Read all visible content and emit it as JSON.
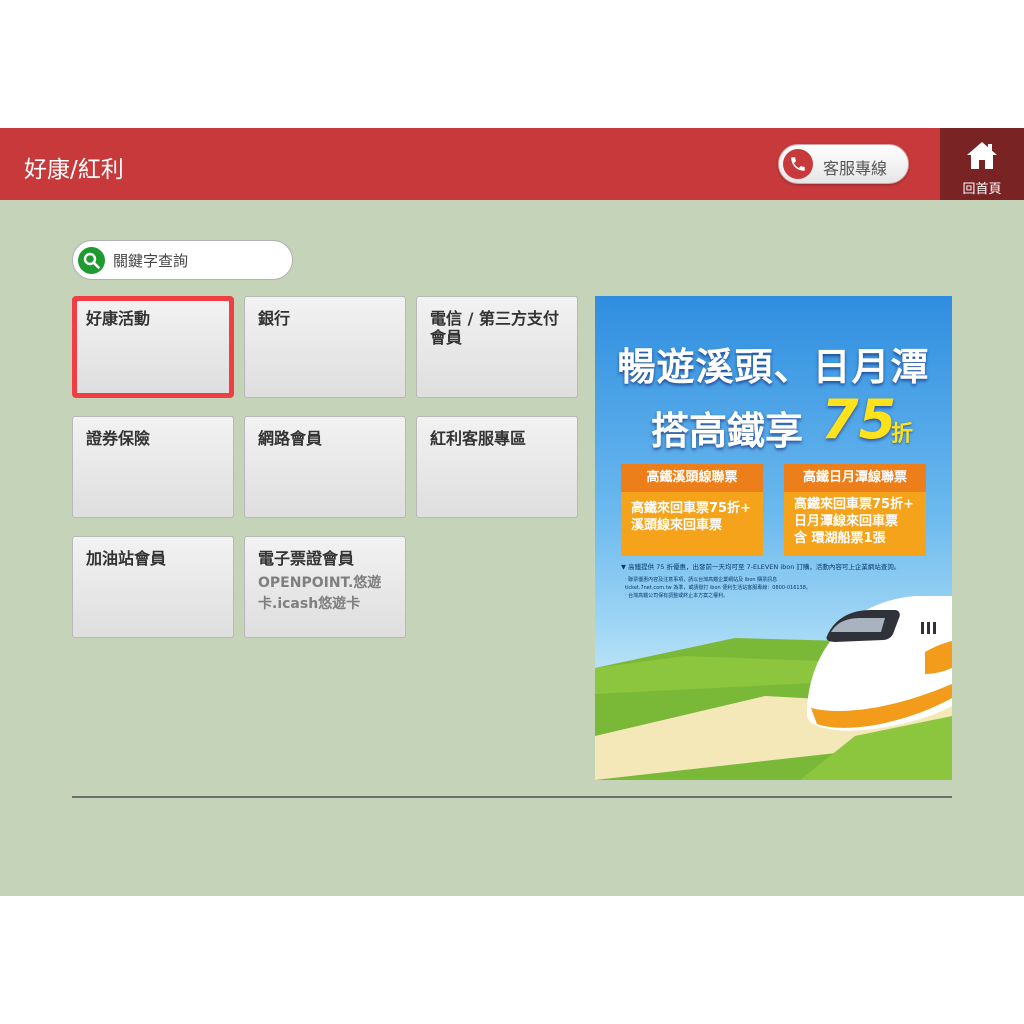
{
  "header": {
    "title": "好康/紅利",
    "customer_service_label": "客服專線",
    "home_label": "回首頁"
  },
  "search": {
    "placeholder": "關鍵字查詢"
  },
  "tiles": [
    {
      "label": "好康活動",
      "sub": "",
      "selected": true
    },
    {
      "label": "銀行",
      "sub": ""
    },
    {
      "label": "電信 / 第三方支付會員",
      "sub": ""
    },
    {
      "label": "證券保險",
      "sub": ""
    },
    {
      "label": "網路會員",
      "sub": ""
    },
    {
      "label": "紅利客服專區",
      "sub": ""
    },
    {
      "label": "加油站會員",
      "sub": ""
    },
    {
      "label": "電子票證會員",
      "sub": "OPENPOINT.悠遊卡.icash悠遊卡"
    }
  ],
  "ad": {
    "headline_1": "暢遊溪頭、日月潭",
    "headline_2": "搭高鐵享",
    "discount_number": "75",
    "discount_unit": "折",
    "box_left": {
      "head": "高鐵溪頭線聯票",
      "line1": "高鐵來回車票75折+",
      "line2": "溪頭線來回車票"
    },
    "box_right": {
      "head": "高鐵日月潭線聯票",
      "line1": "高鐵來回車票75折+",
      "line2": "日月潭線來回車票",
      "line3": "含 環湖船票1張"
    },
    "note": "▼ 高鐵提供 75 折優惠，出發前一天均可至 7-ELEVEN ibon 訂購，活動內容可上企業網站查詢。",
    "fine_1": "‧ 聯票優惠內容及注意事項，請以台灣高鐵企業網站及 ibon 購票訊息",
    "fine_2": "ticket.7net.com.tw 為準，或請撥打 ibon 便利生活站客服專線：0800-016138。",
    "fine_3": "‧ 台灣高鐵公司保有調整或終止本方案之權利。"
  },
  "colors": {
    "header": "#c7393b",
    "home": "#7a2325",
    "background": "#c5d4b9",
    "selected_border": "#ef3f45",
    "search_icon": "#1e9a2e"
  }
}
